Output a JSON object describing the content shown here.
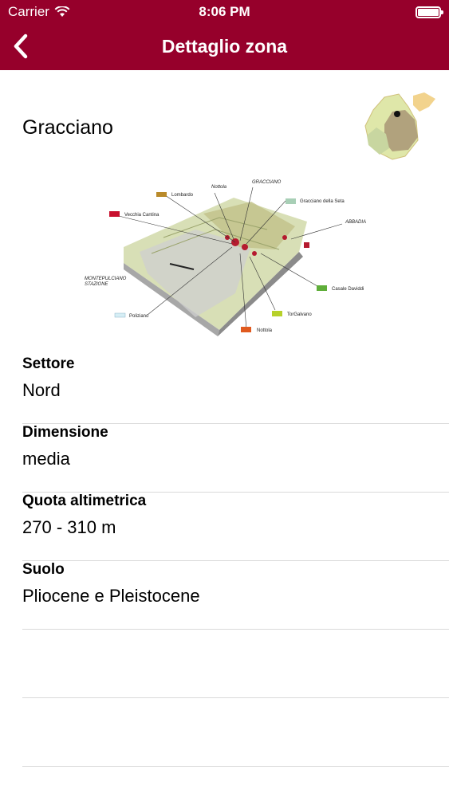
{
  "status_bar": {
    "carrier": "Carrier",
    "time": "8:06 PM"
  },
  "nav": {
    "title": "Dettaglio zona",
    "back_icon": "chevron-left-icon"
  },
  "zone": {
    "name": "Gracciano"
  },
  "map_labels": {
    "lombardo": "Lombardo",
    "nottola_top": "Nottola",
    "gracciano": "GRACCIANO",
    "gracciano_sella": "Gracciano della Seta",
    "vecchia_cantina": "Vecchia Cantina",
    "abbadia": "ABBADIA",
    "montepulciano_1": "MONTEPULCIANO",
    "montepulciano_2": "STAZIONE",
    "casale_daviddi": "Casale Daviddi",
    "poliziano": "Poliziano",
    "torgalvano": "TorGalvano",
    "nottola_bottom": "Nottola"
  },
  "fields": [
    {
      "label": "Settore",
      "value": "Nord"
    },
    {
      "label": "Dimensione",
      "value": "media"
    },
    {
      "label": "Quota altimetrica",
      "value": "270 - 310 m"
    },
    {
      "label": "Suolo",
      "value": "Pliocene e Pleistocene"
    }
  ],
  "colors": {
    "nav_background": "#96002b",
    "separator": "#d9d9d9"
  }
}
